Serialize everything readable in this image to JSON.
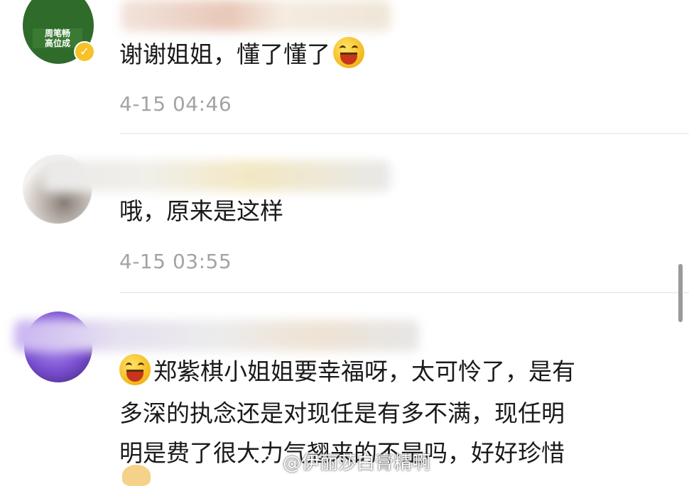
{
  "comments": [
    {
      "avatar_badge_text": "周笔畅\n高位成",
      "text": "谢谢姐姐，懂了懂了",
      "time": "4-15 04:46"
    },
    {
      "text": "哦，原来是这样",
      "time": "4-15 03:55"
    },
    {
      "text_lines": [
        "郑紫棋小姐姐要幸福呀，太可怜了，是有",
        "多深的执念还是对现任是有多不满，现任明",
        "明是费了很大力气翘来的不是吗，好好珍惜"
      ]
    }
  ],
  "watermark": "@伊丽莎白膏精啊",
  "colors": {
    "time": "#a3a3a3",
    "verified_badge": "#f5c22a",
    "avatar_green": "#2f6b2a",
    "avatar_purple": "#7a4fd1"
  }
}
